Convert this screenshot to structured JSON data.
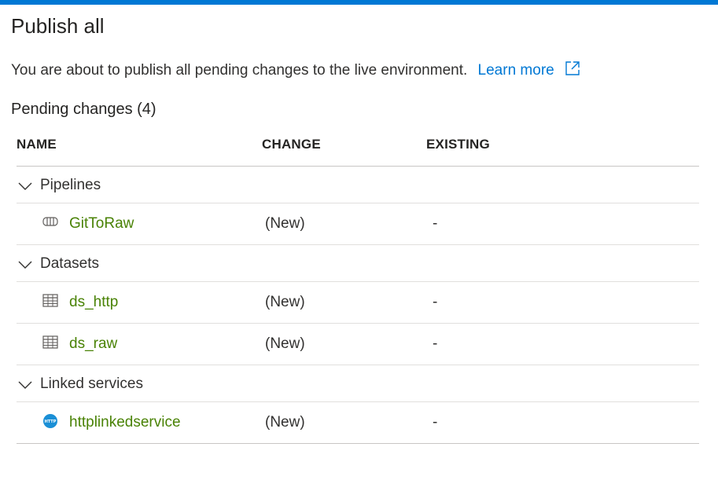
{
  "dialog": {
    "title": "Publish all",
    "description": "You are about to publish all pending changes to the live environment.",
    "learn_more": "Learn more",
    "pending_label": "Pending changes (4)"
  },
  "table": {
    "headers": {
      "name": "NAME",
      "change": "CHANGE",
      "existing": "EXISTING"
    },
    "groups": [
      {
        "label": "Pipelines",
        "items": [
          {
            "name": "GitToRaw",
            "icon": "pipeline-icon",
            "change": "(New)",
            "existing": "-"
          }
        ]
      },
      {
        "label": "Datasets",
        "items": [
          {
            "name": "ds_http",
            "icon": "table-icon",
            "change": "(New)",
            "existing": "-"
          },
          {
            "name": "ds_raw",
            "icon": "table-icon",
            "change": "(New)",
            "existing": "-"
          }
        ]
      },
      {
        "label": "Linked services",
        "items": [
          {
            "name": "httplinkedservice",
            "icon": "http-icon",
            "change": "(New)",
            "existing": "-"
          }
        ]
      }
    ]
  },
  "colors": {
    "accent": "#0078d4",
    "item_link": "#498205",
    "http_icon": "#1a8fd6"
  }
}
